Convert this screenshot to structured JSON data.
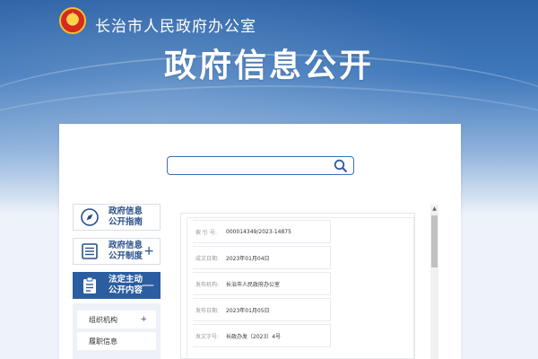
{
  "header": {
    "site_name": "长治市人民政府办公室",
    "page_title": "政府信息公开"
  },
  "search": {
    "value": "",
    "placeholder": ""
  },
  "sidebar": {
    "items": [
      {
        "label_line1": "政府信息",
        "label_line2": "公开指南",
        "icon": "compass-icon",
        "expandable": false,
        "active": false
      },
      {
        "label_line1": "政府信息",
        "label_line2": "公开制度",
        "icon": "document-list-icon",
        "expandable": true,
        "expand_symbol": "+",
        "active": false
      },
      {
        "label_line1": "法定主动",
        "label_line2": "公开内容",
        "icon": "clipboard-icon",
        "expandable": true,
        "expand_symbol": "—",
        "active": true
      }
    ],
    "sub_items": [
      {
        "label": "组织机构",
        "expand_symbol": "+"
      },
      {
        "label": "履职信息",
        "expand_symbol": ""
      }
    ]
  },
  "document_info": [
    {
      "key": "索 引 号:",
      "value": "000014349/2023-14875"
    },
    {
      "key": "成文日期:",
      "value": "2023年01月04日"
    },
    {
      "key": "发布机构:",
      "value": "长治市人民政府办公室"
    },
    {
      "key": "发布日期:",
      "value": "2023年01月05日"
    },
    {
      "key": "发文字号:",
      "value": "长政办发〔2023〕4号"
    }
  ],
  "scrollbar": {
    "up_symbol": "▲"
  },
  "colors": {
    "primary": "#2b5da1",
    "banner_top": "#2d63a6",
    "border": "#d9dfe8"
  }
}
